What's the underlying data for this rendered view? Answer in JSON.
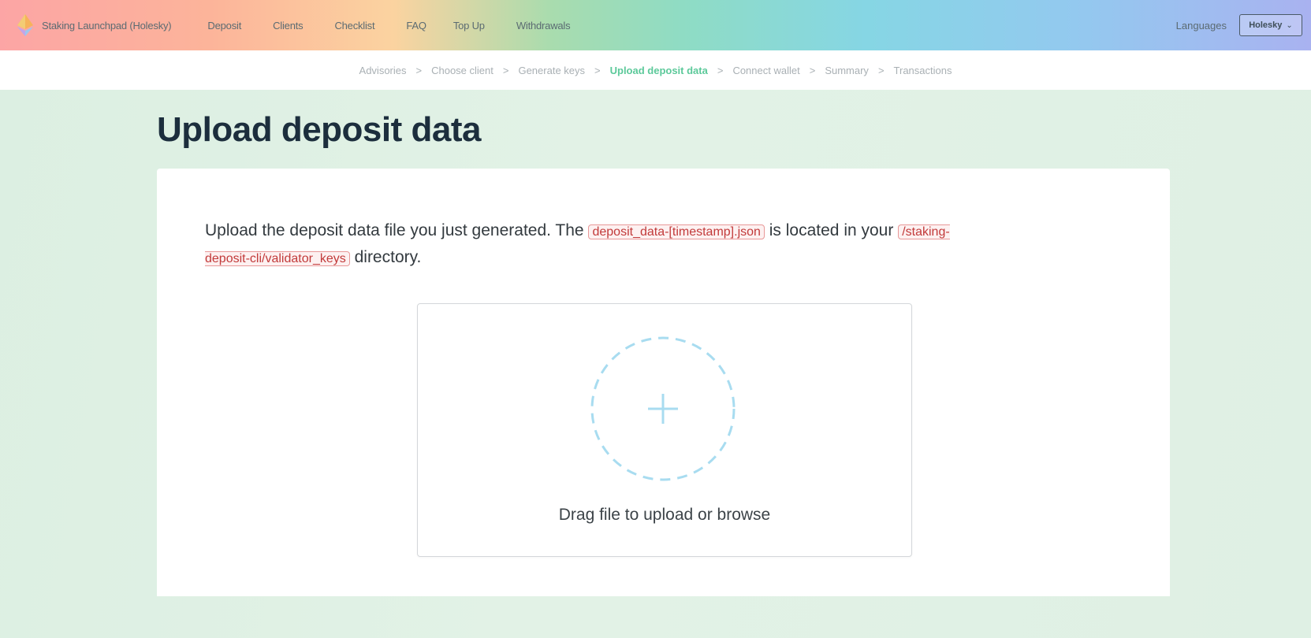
{
  "header": {
    "brand": "Staking Launchpad (Holesky)",
    "nav": [
      "Deposit",
      "Clients",
      "Checklist",
      "FAQ",
      "Top Up",
      "Withdrawals"
    ],
    "languages_label": "Languages",
    "network_select": "Holesky",
    "logo_icon": "ethereum-icon"
  },
  "steps": [
    "Advisories",
    "Choose client",
    "Generate keys",
    "Upload deposit data",
    "Connect wallet",
    "Summary",
    "Transactions"
  ],
  "active_step": "Upload deposit data",
  "main": {
    "title": "Upload deposit data",
    "instruction_part1": "Upload the deposit data file you just generated. The",
    "filename": "deposit_data-[timestamp].json",
    "instruction_part2": "is located in your",
    "directory": "/staking-deposit-cli/validator_keys",
    "instruction_part3": "directory.",
    "dropzone_text": "Drag file to upload or browse",
    "dropzone_icon": "plus-icon"
  },
  "colors": {
    "active_step": "#5cc99a",
    "code_text": "#c23a3a",
    "dropzone_accent": "#a8dcf0",
    "title": "#1c2e3d"
  }
}
